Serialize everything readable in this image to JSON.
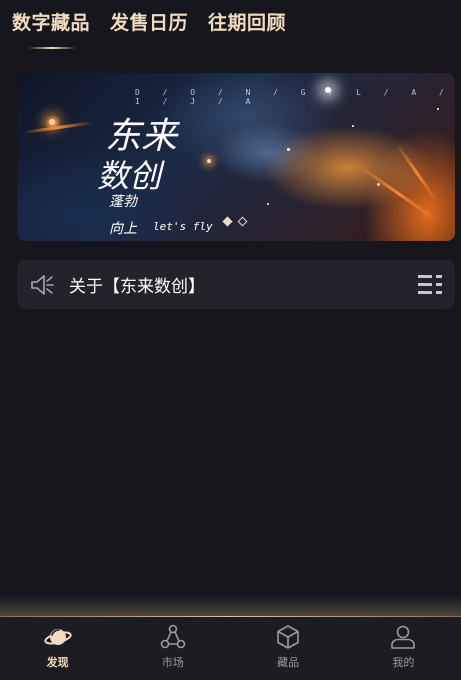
{
  "top_tabs": [
    {
      "label": "数字藏品",
      "active": true
    },
    {
      "label": "发售日历",
      "active": false
    },
    {
      "label": "往期回顾",
      "active": false
    }
  ],
  "banner": {
    "spaced_text": "D / O / N / G / L / A / I / J / A",
    "calligraphy_line1": "东来",
    "calligraphy_line2": "数创",
    "calligraphy_line3": "蓬勃",
    "calligraphy_line4": "向上",
    "english_script": "let's fly",
    "carousel_active_index": 0,
    "carousel_count": 2
  },
  "notice": {
    "icon": "speaker-icon",
    "text": "关于【东来数创】",
    "list_icon": "list-icon"
  },
  "bottom_nav": [
    {
      "label": "发现",
      "icon": "planet-icon",
      "active": true
    },
    {
      "label": "市场",
      "icon": "network-icon",
      "active": false
    },
    {
      "label": "藏品",
      "icon": "box-icon",
      "active": false
    },
    {
      "label": "我的",
      "icon": "user-icon",
      "active": false
    }
  ],
  "colors": {
    "background": "#17161c",
    "accent_gold": "#f0dcc0",
    "card": "#24232b",
    "nav_inactive": "#9a99a2"
  }
}
